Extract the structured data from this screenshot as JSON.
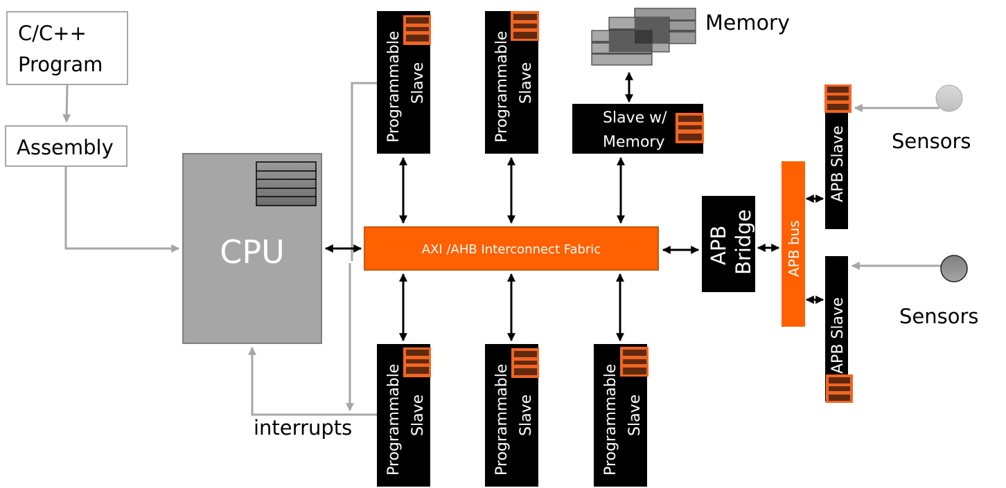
{
  "nodes": {
    "program": {
      "line1": "C/C++",
      "line2": "Program"
    },
    "assembly": {
      "label": "Assembly"
    },
    "cpu": {
      "label": "CPU"
    },
    "fabric": {
      "label": "AXI /AHB  Interconnect  Fabric"
    },
    "apb_bridge": {
      "line1": "APB",
      "line2": "Bridge"
    },
    "apb_bus": {
      "label": "APB bus"
    },
    "apb_slave_top": {
      "label": "APB Slave"
    },
    "apb_slave_bottom": {
      "label": "APB Slave"
    },
    "memory": {
      "label": "Memory"
    },
    "slave_memory": {
      "line1": "Slave w/",
      "line2": "Memory"
    },
    "sensors_top": {
      "label": "Sensors"
    },
    "sensors_bottom": {
      "label": "Sensors"
    },
    "interrupts": {
      "label": "interrupts"
    },
    "programmable_slaves": [
      {
        "line1": "Programmable",
        "line2": "Slave",
        "position": "top-1"
      },
      {
        "line1": "Programmable",
        "line2": "Slave",
        "position": "top-2"
      },
      {
        "line1": "Programmable",
        "line2": "Slave",
        "position": "bottom-1"
      },
      {
        "line1": "Programmable",
        "line2": "Slave",
        "position": "bottom-2"
      },
      {
        "line1": "Programmable",
        "line2": "Slave",
        "position": "bottom-3"
      }
    ]
  },
  "colors": {
    "fabric_orange": "#ff6000",
    "register_orange": "#f26522",
    "register_dark": "#612a10",
    "cpu_gray": "#a6a6a6",
    "slave_black": "#000000",
    "connector_gray": "#a6a6a6"
  }
}
